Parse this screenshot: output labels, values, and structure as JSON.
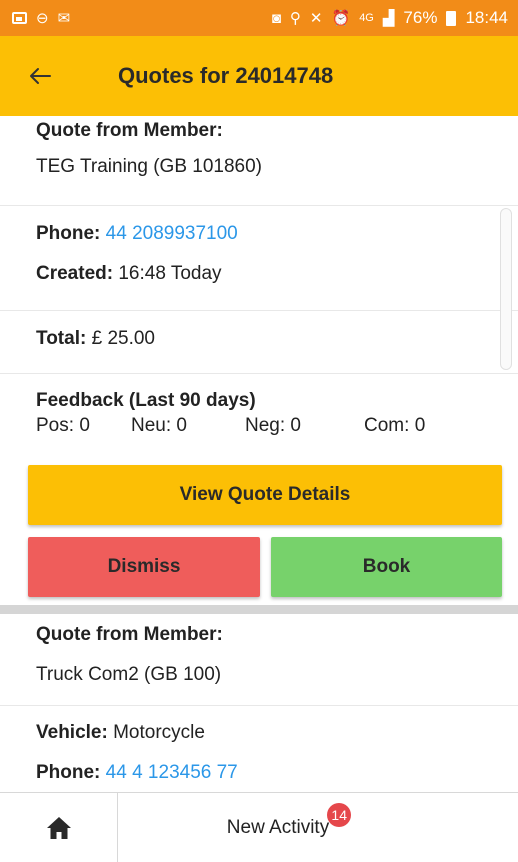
{
  "status_bar": {
    "left_icons": [
      "image-icon",
      "sync-icon",
      "gmail-icon"
    ],
    "right_icons": [
      "lock-icon",
      "location-icon",
      "mute-icon",
      "alarm-icon",
      "4g-icon",
      "signal-icon"
    ],
    "network": "4G",
    "battery": "76%",
    "time": "18:44"
  },
  "app_bar": {
    "title": "Quotes for 24014748",
    "back_icon": "arrow-left-icon"
  },
  "quotes": [
    {
      "member_label": "Quote from Member:",
      "member_name": "TEG Training (GB 101860)",
      "phone_label": "Phone:",
      "phone": "44 2089937100",
      "created_label": "Created:",
      "created": "16:48 Today",
      "total_label": "Total:",
      "total": "£ 25.00",
      "feedback_title": "Feedback (Last 90 days)",
      "feedback": [
        {
          "label": "Pos:",
          "value": "0"
        },
        {
          "label": "Neu:",
          "value": "0"
        },
        {
          "label": "Neg:",
          "value": "0"
        },
        {
          "label": "Com:",
          "value": "0"
        }
      ],
      "view_details_label": "View Quote Details",
      "dismiss_label": "Dismiss",
      "book_label": "Book"
    },
    {
      "member_label": "Quote from Member:",
      "member_name": "Truck Com2 (GB 100)",
      "vehicle_label": "Vehicle:",
      "vehicle": "Motorcycle",
      "phone_label": "Phone:",
      "phone": "44 4 123456 77"
    }
  ],
  "bottom_bar": {
    "home_icon": "home-icon",
    "activity_label": "New Activity",
    "activity_badge": "14"
  },
  "colors": {
    "status_bar": "#f28c18",
    "app_bar": "#fcbf05",
    "link": "#2b97e8",
    "dismiss": "#ef5d5b",
    "book": "#77d26b",
    "badge": "#e5474b"
  }
}
